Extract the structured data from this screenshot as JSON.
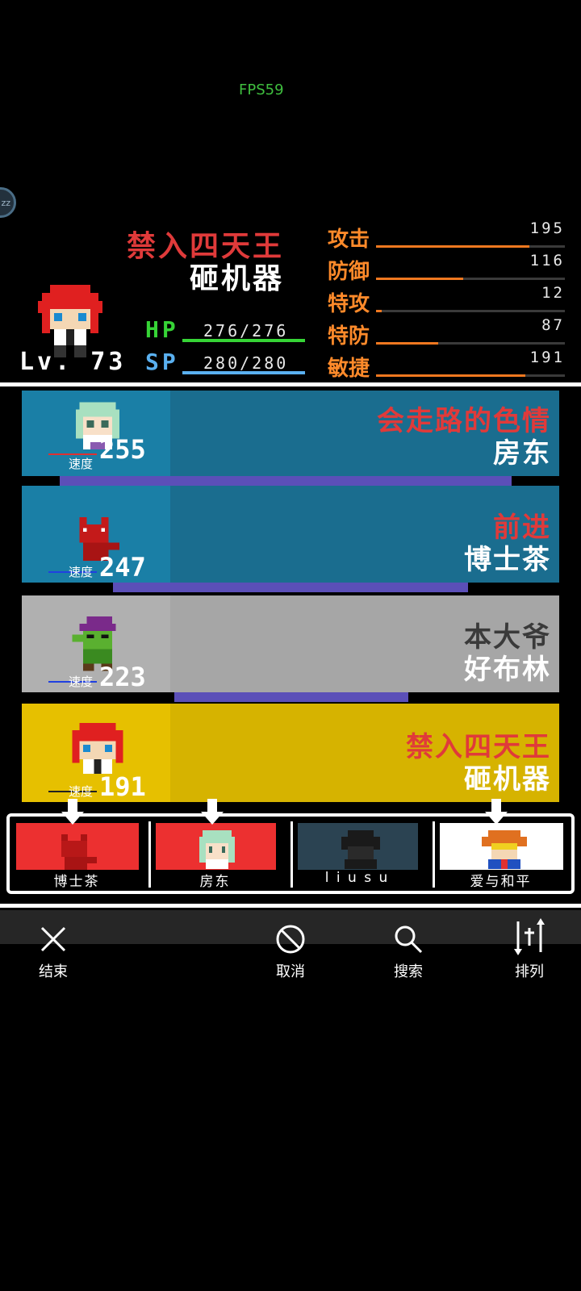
{
  "fps": "FPS59",
  "float_button": "zz",
  "hero": {
    "title_line1": "禁入四天王",
    "title_line2": "砸机器",
    "level": "Lv. 73",
    "hp_label": "HP",
    "hp_value": "276/276",
    "sp_label": "SP",
    "sp_value": "280/280",
    "hp_fraction": 1.0,
    "sp_fraction": 1.0
  },
  "attributes": [
    {
      "label": "攻击",
      "value": "195",
      "fraction": 0.81
    },
    {
      "label": "防御",
      "value": "116",
      "fraction": 0.46
    },
    {
      "label": "特攻",
      "value": "12",
      "fraction": 0.03
    },
    {
      "label": "特防",
      "value": "87",
      "fraction": 0.33
    },
    {
      "label": "敏捷",
      "value": "191",
      "fraction": 0.79
    }
  ],
  "turn_order": [
    {
      "name_line1": "会走路的色情",
      "name_line2": "房东",
      "speed": "255",
      "speed_label": "速度",
      "name1_color": "#e03a3a",
      "bg_left": "#1a7fa6",
      "bg_right": "#1a6d8f"
    },
    {
      "name_line1": "前进",
      "name_line2": "博士茶",
      "speed": "247",
      "speed_label": "速度",
      "name1_color": "#e03a3a",
      "bg_left": "#1a7fa6",
      "bg_right": "#1a6d8f"
    },
    {
      "name_line1": "本大爷",
      "name_line2": "好布林",
      "speed": "223",
      "speed_label": "速度",
      "name1_color": "#3a3a3a",
      "bg_left": "#b0b0b0",
      "bg_right": "#a6a6a6"
    },
    {
      "name_line1": "禁入四天王",
      "name_line2": "砸机器",
      "speed": "191",
      "speed_label": "速度",
      "name1_color": "#e03a3a",
      "bg_left": "#e6c000",
      "bg_right": "#d6b300"
    }
  ],
  "party": [
    {
      "name": "博士茶",
      "bg": "#ec3030"
    },
    {
      "name": "房东",
      "bg": "#ec3030"
    },
    {
      "name": "l i u s u",
      "bg": "#2b4352"
    },
    {
      "name": "爱与和平",
      "bg": "#ffffff"
    }
  ],
  "toolbar": {
    "end": "结束",
    "cancel": "取消",
    "search": "搜索",
    "sort": "排列"
  }
}
